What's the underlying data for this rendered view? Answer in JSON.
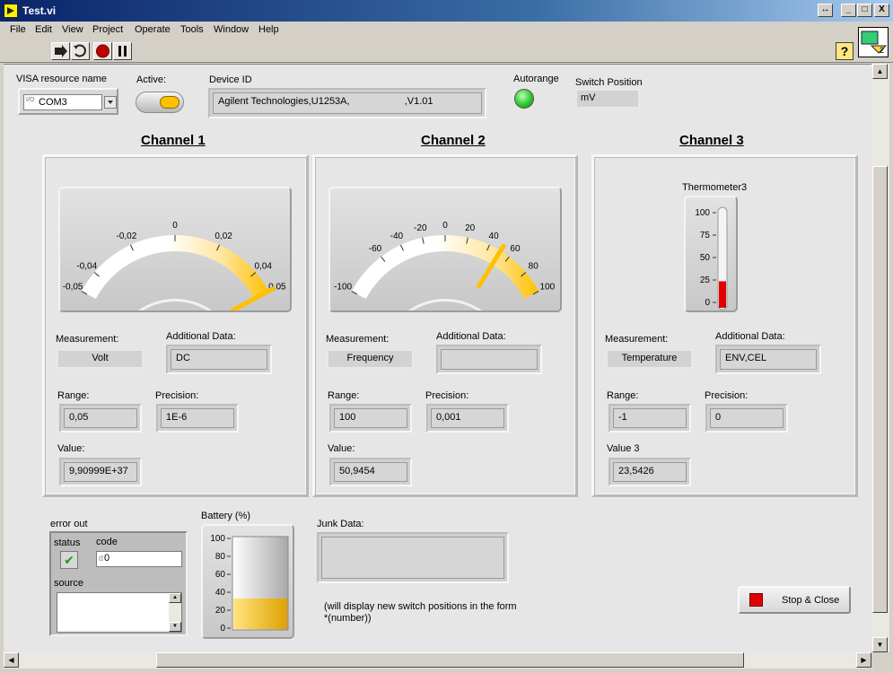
{
  "window": {
    "title": "Test.vi",
    "resize_glyph": "↔",
    "min_glyph": "_",
    "max_glyph": "□",
    "close_glyph": "X"
  },
  "menu": [
    "File",
    "Edit",
    "View",
    "Project",
    "Operate",
    "Tools",
    "Window",
    "Help"
  ],
  "toolbar": {
    "help_glyph": "?",
    "vi_icon_number": "2"
  },
  "top": {
    "visa_label": "VISA resource name",
    "visa_prefix": "I/O",
    "visa_value": "COM3",
    "active_label": "Active:",
    "device_id_label": "Device ID",
    "device_id_value": "Agilent Technologies,U1253A,                    ,V1.01",
    "autorange_label": "Autorange",
    "switch_label": "Switch Position",
    "switch_value": "mV"
  },
  "channels": [
    {
      "title": "Channel 1",
      "meter": {
        "ticks": [
          "-0,05",
          "-0,04",
          "-0,02",
          "0",
          "0,02",
          "0,04",
          "0,05"
        ],
        "min": -0.05,
        "max": 0.05,
        "needle": 0.05
      },
      "measurement_label": "Measurement:",
      "measurement": "Volt",
      "additional_label": "Additional Data:",
      "additional": "DC",
      "range_label": "Range:",
      "range": "0,05",
      "precision_label": "Precision:",
      "precision": "1E-6",
      "value_label": "Value:",
      "value": "9,90999E+37"
    },
    {
      "title": "Channel 2",
      "meter": {
        "ticks": [
          "-100",
          "-60",
          "-40",
          "-20",
          "0",
          "20",
          "40",
          "60",
          "80",
          "100"
        ],
        "min": -100,
        "max": 100,
        "needle": 50.9454
      },
      "measurement_label": "Measurement:",
      "measurement": "Frequency",
      "additional_label": "Additional Data:",
      "additional": "",
      "range_label": "Range:",
      "range": "100",
      "precision_label": "Precision:",
      "precision": "0,001",
      "value_label": "Value:",
      "value": "50,9454"
    },
    {
      "title": "Channel 3",
      "thermometer": {
        "label": "Thermometer3",
        "ticks": [
          "100",
          "75",
          "50",
          "25",
          "0"
        ],
        "min": 0,
        "max": 100,
        "value": 23.5426
      },
      "measurement_label": "Measurement:",
      "measurement": "Temperature",
      "additional_label": "Additional Data:",
      "additional": "ENV,CEL",
      "range_label": "Range:",
      "range": "-1",
      "precision_label": "Precision:",
      "precision": "0",
      "value_label": "Value 3",
      "value": "23,5426"
    }
  ],
  "error_out": {
    "label": "error out",
    "status_label": "status",
    "status_glyph": "✔",
    "code_label": "code",
    "code_prefix": "d",
    "code_value": "0",
    "source_label": "source"
  },
  "battery": {
    "label": "Battery (%)",
    "ticks": [
      "100",
      "80",
      "60",
      "40",
      "20",
      "0"
    ],
    "min": 0,
    "max": 100,
    "value": 33
  },
  "junk": {
    "label": "Junk Data:",
    "value": "",
    "note": "(will display new switch positions in the form\n*(number))"
  },
  "stop_button": {
    "label": "Stop & Close"
  },
  "colors": {
    "accent_orange": "#ffc000",
    "led_green": "#2ec82e",
    "stop_red": "#e00000",
    "thermo_red": "#e00000"
  }
}
